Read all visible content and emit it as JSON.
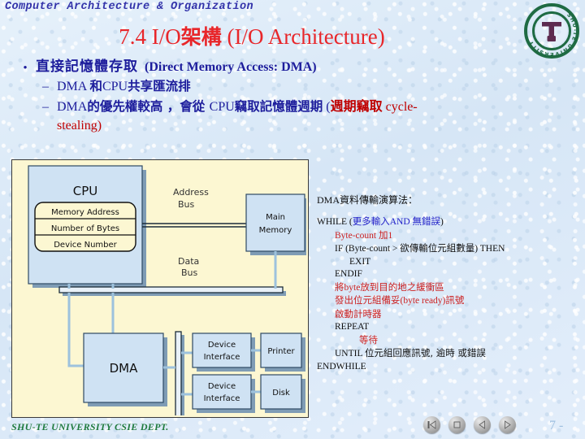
{
  "header": {
    "kicker": "Computer Architecture & Organization"
  },
  "title": {
    "num": "7.4 I/O",
    "cjk": "架構",
    "en": "(I/O Architecture)"
  },
  "logo": {
    "name": "shu-te-university-seal",
    "ring_text": "SHU-TE UNIVERSITY",
    "ring_color": "#1f6b43",
    "mark_color": "#5d2b4f"
  },
  "bullets": {
    "level1": {
      "marker": "•",
      "cjk": "直接記憶體存取",
      "en": "(Direct Memory Access: DMA)"
    },
    "level2": [
      {
        "marker": "–",
        "parts": [
          {
            "text": "DMA ",
            "style": "en"
          },
          {
            "text": "和",
            "style": "cjk"
          },
          {
            "text": "CPU",
            "style": "en"
          },
          {
            "text": "共享匯流排",
            "style": "cjk"
          }
        ]
      },
      {
        "marker": "–",
        "parts": [
          {
            "text": "DMA",
            "style": "en"
          },
          {
            "text": "的優先權較高 ，會從 ",
            "style": "cjk"
          },
          {
            "text": "CPU",
            "style": "en"
          },
          {
            "text": "竊取記憶體週期",
            "style": "cjk"
          },
          {
            "text": "  (",
            "style": "en"
          },
          {
            "text": "週期竊取",
            "style": "redcjk"
          },
          {
            "text": " cycle-",
            "style": "red"
          }
        ]
      }
    ],
    "continuation": "stealing)"
  },
  "diagram": {
    "name": "dma-block-diagram",
    "background": "#fcf7d2",
    "box_fill": "#cfe2f3",
    "register_fill": "#fcf7d2",
    "cpu": {
      "label": "CPU",
      "registers": [
        "Memory Address",
        "Number of Bytes",
        "Device Number"
      ]
    },
    "main_memory": {
      "line1": "Main",
      "line2": "Memory"
    },
    "dma": {
      "label": "DMA"
    },
    "buses": {
      "address": [
        "Address",
        "Bus"
      ],
      "data": [
        "Data",
        "Bus"
      ]
    },
    "interfaces": [
      {
        "line1": "Device",
        "line2": "Interface",
        "device": "Printer"
      },
      {
        "line1": "Device",
        "line2": "Interface",
        "device": "Disk"
      }
    ]
  },
  "algorithm": {
    "heading": {
      "en": "DMA",
      "cjk": "資料傳輸演算法："
    },
    "lines": [
      {
        "indent": 0,
        "parts": [
          {
            "t": "WHILE (",
            "s": "en"
          },
          {
            "t": "更多輸入",
            "s": "bluecjk"
          },
          {
            "t": "AND ",
            "s": "blue"
          },
          {
            "t": "無錯誤",
            "s": "bluecjk"
          },
          {
            "t": ")",
            "s": "en"
          }
        ]
      },
      {
        "indent": 1,
        "parts": [
          {
            "t": "Byte-count ",
            "s": "red"
          },
          {
            "t": "加",
            "s": "redcjk"
          },
          {
            "t": "1",
            "s": "red"
          }
        ]
      },
      {
        "indent": 1,
        "parts": [
          {
            "t": "IF (Byte-count > ",
            "s": "en"
          },
          {
            "t": "欲傳輸位元組數量",
            "s": "cjk"
          },
          {
            "t": ") THEN",
            "s": "en"
          }
        ]
      },
      {
        "indent": 2,
        "parts": [
          {
            "t": "EXIT",
            "s": "en"
          }
        ]
      },
      {
        "indent": 1,
        "parts": [
          {
            "t": "ENDIF",
            "s": "en"
          }
        ]
      },
      {
        "indent": 1,
        "parts": [
          {
            "t": "將",
            "s": "redcjk"
          },
          {
            "t": "byte",
            "s": "red"
          },
          {
            "t": "放到目的地之緩衝區",
            "s": "redcjk"
          }
        ]
      },
      {
        "indent": 1,
        "parts": [
          {
            "t": "發出位元組備妥",
            "s": "redcjk"
          },
          {
            "t": "(byte ready)",
            "s": "red"
          },
          {
            "t": "訊號",
            "s": "redcjk"
          }
        ]
      },
      {
        "indent": 1,
        "parts": [
          {
            "t": "啟動計時器",
            "s": "redcjk"
          }
        ]
      },
      {
        "indent": 1,
        "parts": [
          {
            "t": "REPEAT",
            "s": "en"
          }
        ]
      },
      {
        "indent": 3,
        "parts": [
          {
            "t": "等待",
            "s": "redcjk"
          }
        ]
      },
      {
        "indent": 1,
        "parts": [
          {
            "t": "UNTIL ",
            "s": "en"
          },
          {
            "t": "位元組回應訊號, 逾時 或錯誤",
            "s": "cjk"
          }
        ]
      },
      {
        "indent": 0,
        "parts": [
          {
            "t": "ENDWHILE",
            "s": "en"
          }
        ]
      }
    ]
  },
  "footer": {
    "text": "SHU-TE UNIVERSITY  CSIE DEPT.",
    "page": "7 -",
    "nav": [
      {
        "name": "nav-first-button",
        "glyph": "first"
      },
      {
        "name": "nav-stop-button",
        "glyph": "stop"
      },
      {
        "name": "nav-previous-button",
        "glyph": "prev"
      },
      {
        "name": "nav-next-button",
        "glyph": "next"
      }
    ]
  }
}
